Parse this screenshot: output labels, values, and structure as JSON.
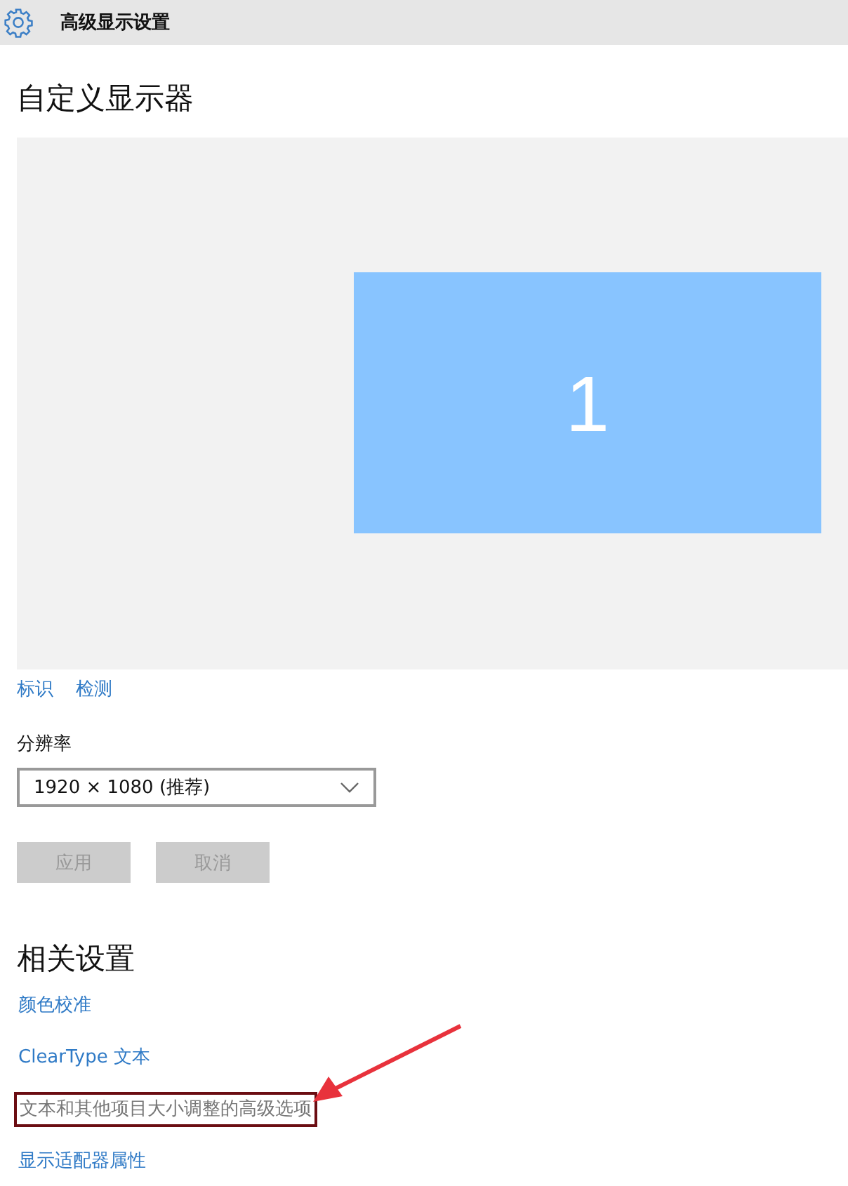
{
  "header": {
    "title": "高级显示设置"
  },
  "heading": "自定义显示器",
  "preview": {
    "monitors": [
      {
        "label": "1",
        "selected": true
      }
    ]
  },
  "preview_links": [
    "标识",
    "检测"
  ],
  "resolution": {
    "label": "分辨率",
    "value": "1920 × 1080 (推荐)"
  },
  "buttons": [
    {
      "label": "应用",
      "disabled": true
    },
    {
      "label": "取消",
      "disabled": true
    }
  ],
  "related": {
    "heading": "相关设置",
    "links": [
      {
        "label": "颜色校准",
        "highlighted": false
      },
      {
        "label": "ClearType 文本",
        "highlighted": false
      },
      {
        "label": "文本和其他项目大小调整的高级选项",
        "highlighted": true
      },
      {
        "label": "显示适配器属性",
        "highlighted": false
      }
    ]
  }
}
